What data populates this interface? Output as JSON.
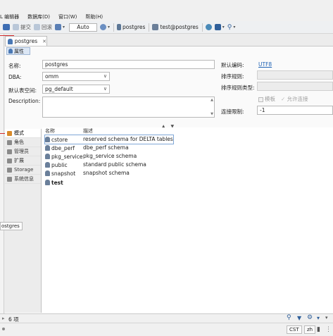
{
  "menu": [
    "L 编辑器",
    "数据库(D)",
    "窗口(W)",
    "帮助(H)"
  ],
  "toolbar": {
    "commit": "提交",
    "rollback": "回滚",
    "mode": "Auto",
    "datasource": "postgres",
    "connection": "test@postgres"
  },
  "editor_tab": "postgres",
  "sub_tab": "属性",
  "form": {
    "name_label": "名称:",
    "name_value": "postgres",
    "dba_label": "DBA:",
    "dba_value": "omm",
    "tablespace_label": "默认表空间:",
    "tablespace_value": "pg_default",
    "description_label": "Description:"
  },
  "props": {
    "encoding_label": "默认编码:",
    "encoding_value": "UTF8",
    "collation_label": "排序规则:",
    "ctype_label": "排序规则类型:",
    "template_label": "模板",
    "allow_conn_label": "允许连接",
    "conn_limit_label": "连接限制:",
    "conn_limit_value": "-1"
  },
  "vtabs": [
    "模式",
    "角色",
    "管理员",
    "扩展",
    "Storage",
    "系统信息"
  ],
  "table": {
    "col_name": "名称",
    "col_desc": "描述",
    "rows": [
      {
        "name": "cstore",
        "desc": "reserved schema for DELTA tables"
      },
      {
        "name": "dbe_perf",
        "desc": "dbe_perf schema"
      },
      {
        "name": "pkg_service",
        "desc": "pkg_service schema"
      },
      {
        "name": "public",
        "desc": "standard public schema"
      },
      {
        "name": "snapshot",
        "desc": "snapshot schema"
      },
      {
        "name": "test",
        "desc": ""
      }
    ]
  },
  "tooltip": "ostgres",
  "status": {
    "count": "6 项",
    "timezone": "CST",
    "locale": "zh"
  },
  "colors": {
    "accent": "#1f63b5",
    "selection_marker": "#d42a2a",
    "active_tab_icon": "#d88a2a"
  }
}
